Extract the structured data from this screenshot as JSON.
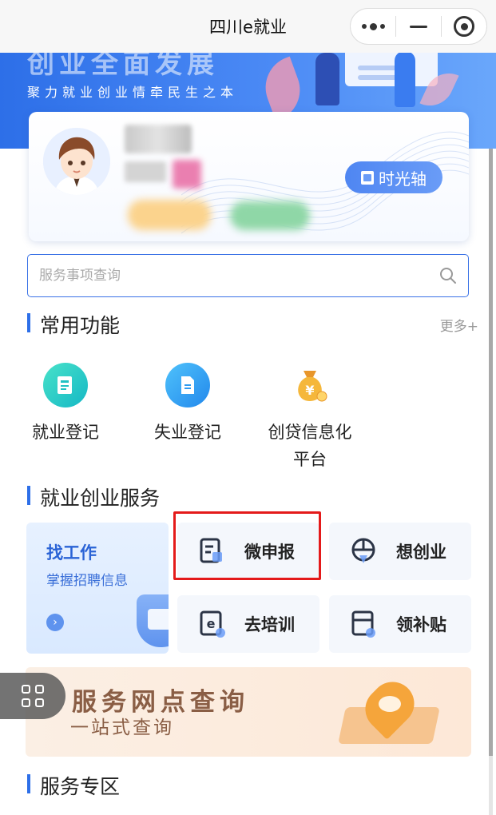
{
  "window": {
    "title": "四川e就业",
    "capsule": {
      "menu_icon": "more-dots-icon",
      "minimize_icon": "minus-icon",
      "close_icon": "target-circle-icon"
    }
  },
  "banner": {
    "big_title": "创业全面发展",
    "slogan": "聚力就业创业情牵民生之本"
  },
  "profile": {
    "avatar_icon": "cartoon-avatar-icon",
    "timeline_label": "时光轴"
  },
  "search": {
    "placeholder": "服务事项查询"
  },
  "common": {
    "title": "常用功能",
    "more": "更多+",
    "items": [
      {
        "label": "就业登记",
        "icon": "employment-register-icon",
        "color": "#1fc7c1"
      },
      {
        "label": "失业登记",
        "icon": "unemployment-register-icon",
        "color": "#2f9bf0"
      },
      {
        "label": "创贷信息化平台",
        "label_line1": "创贷信息化",
        "label_line2": "平台",
        "icon": "money-bag-icon",
        "color": "#f5a623"
      }
    ]
  },
  "services": {
    "title": "就业创业服务",
    "job_card": {
      "title": "找工作",
      "subtitle": "掌握招聘信息",
      "arrow": "›"
    },
    "items": [
      {
        "label": "微申报",
        "icon": "document-form-icon"
      },
      {
        "label": "想创业",
        "icon": "startup-compass-icon"
      },
      {
        "label": "去培训",
        "icon": "e-learning-icon"
      },
      {
        "label": "领补贴",
        "icon": "subsidy-icon"
      }
    ]
  },
  "outlet": {
    "title": "服务网点查询",
    "subtitle": "一站式查询"
  },
  "zone": {
    "title": "服务专区"
  },
  "colors": {
    "primary": "#2d6fe8",
    "highlight": "#e41a1a"
  }
}
